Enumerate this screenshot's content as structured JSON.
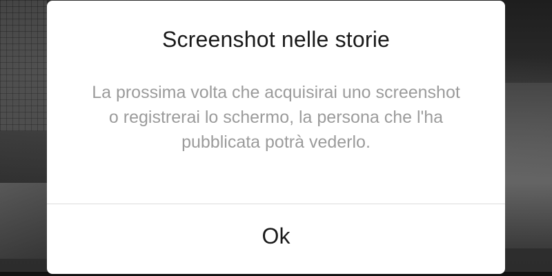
{
  "dialog": {
    "title": "Screenshot nelle storie",
    "message": "La prossima volta che acquisirai uno screenshot o registrerai lo schermo, la persona che l'ha pubblicata potrà vederlo.",
    "ok_label": "Ok"
  },
  "colors": {
    "dialog_background": "#ffffff",
    "title_text": "#1a1a1a",
    "message_text": "#9b9b9b",
    "divider": "#dcdcdc",
    "backdrop": "#2a2a2a"
  }
}
